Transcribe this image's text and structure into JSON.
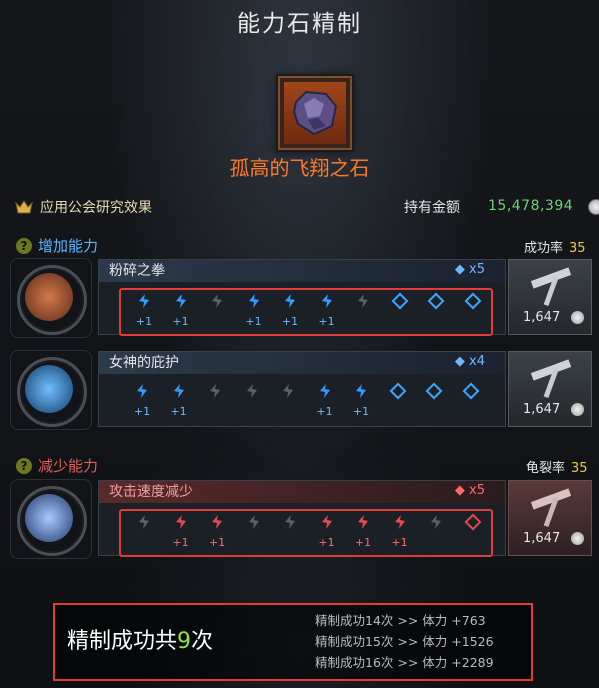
{
  "header": {
    "title": "能力石精制"
  },
  "item": {
    "name": "孤高的飞翔之石"
  },
  "guild": {
    "label": "应用公会研究效果"
  },
  "gold": {
    "label": "持有金额",
    "value": "15,478,394"
  },
  "increase": {
    "title": "增加能力",
    "rate_label": "成功率",
    "rate_value": "35",
    "rows": [
      {
        "name": "粉碎之拳",
        "count": "x5",
        "cost": "1,647",
        "slots": [
          "blue",
          "blue",
          "gray",
          "blue",
          "blue",
          "blue",
          "gray",
          "dia",
          "dia",
          "dia"
        ],
        "plus": [
          "+1",
          "+1",
          "",
          "+1",
          "+1",
          "+1",
          "",
          "",
          "",
          ""
        ]
      },
      {
        "name": "女神的庇护",
        "count": "x4",
        "cost": "1,647",
        "slots": [
          "blue",
          "blue",
          "gray",
          "gray",
          "gray",
          "blue",
          "blue",
          "dia",
          "dia",
          "dia"
        ],
        "plus": [
          "+1",
          "+1",
          "",
          "",
          "",
          "+1",
          "+1",
          "",
          "",
          ""
        ]
      }
    ]
  },
  "decrease": {
    "title": "减少能力",
    "rate_label": "龟裂率",
    "rate_value": "35",
    "rows": [
      {
        "name": "攻击速度减少",
        "count": "x5",
        "cost": "1,647",
        "slots": [
          "gray",
          "red",
          "red",
          "gray",
          "gray",
          "red",
          "red",
          "red",
          "gray",
          "rdia"
        ],
        "plus": [
          "",
          "+1",
          "+1",
          "",
          "",
          "+1",
          "+1",
          "+1",
          "",
          ""
        ]
      }
    ]
  },
  "summary": {
    "prefix": "精制成功共",
    "count": "9",
    "suffix": "次",
    "lines": [
      "精制成功14次 >> 体力 +763",
      "精制成功15次 >> 体力 +1526",
      "精制成功16次 >> 体力 +2289"
    ]
  },
  "colors": {
    "accent_orange": "#ff7a24",
    "gold_green": "#6fd27a",
    "success_blue": "#2f8ef0",
    "fail_red": "#e23b3b"
  }
}
